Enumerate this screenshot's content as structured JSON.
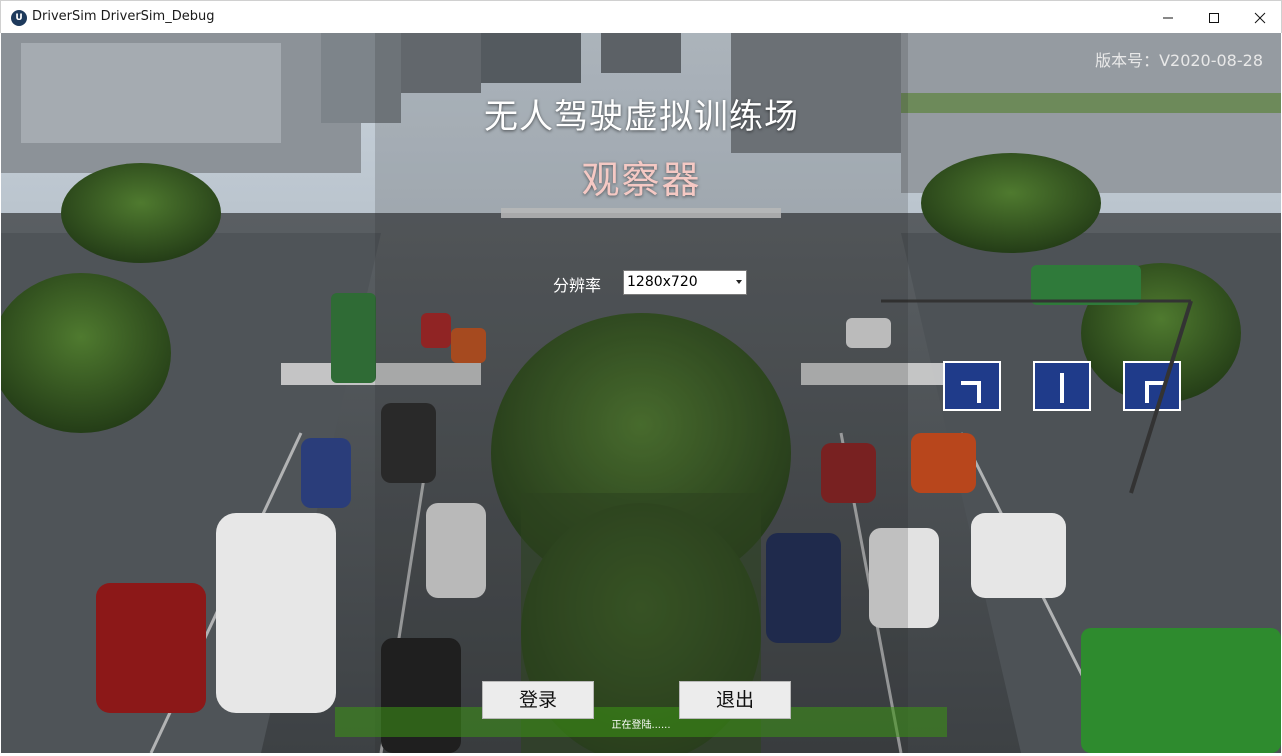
{
  "window": {
    "title": "DriverSim DriverSim_Debug",
    "icon": "unreal-logo-icon"
  },
  "app": {
    "version": "版本号：V2020-08-28",
    "title": "无人驾驶虚拟训练场",
    "subtitle": "观察器"
  },
  "resolution": {
    "label": "分辨率",
    "selected": "1280x720"
  },
  "actions": {
    "login": "登录",
    "exit": "退出"
  },
  "status": {
    "text": "正在登陆......"
  },
  "colors": {
    "title_text": "#ffffff",
    "subtitle_text": "#f5c9c4",
    "status_bar": "#3c9614",
    "button_bg": "#ececec"
  }
}
